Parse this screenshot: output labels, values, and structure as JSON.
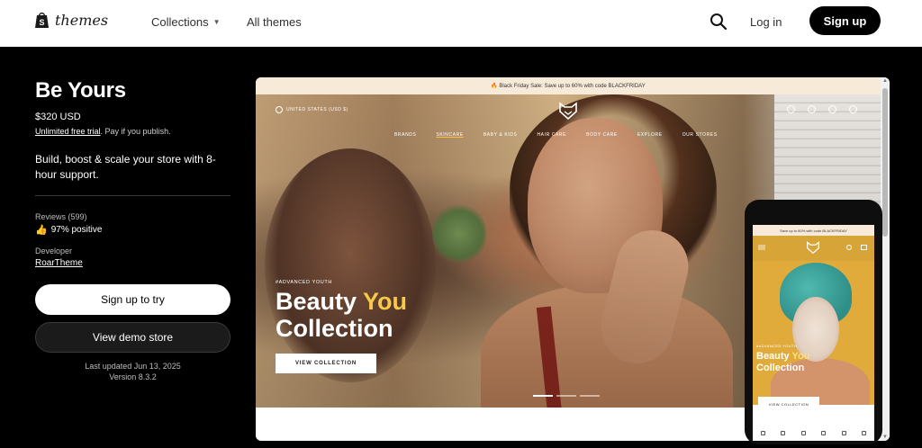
{
  "topnav": {
    "brand": "themes",
    "collections_label": "Collections",
    "all_themes_label": "All themes",
    "login_label": "Log in",
    "signup_label": "Sign up"
  },
  "theme": {
    "name": "Be Yours",
    "price": "$320 USD",
    "trial_link": "Unlimited free trial",
    "trial_suffix": ". Pay if you publish.",
    "tagline": "Build, boost & scale your store with 8-hour support.",
    "reviews_label": "Reviews (599)",
    "reviews_value": "97% positive",
    "developer_label": "Developer",
    "developer_name": "RoarTheme",
    "try_button": "Sign up to try",
    "demo_button": "View demo store",
    "last_updated": "Last updated Jun 13, 2025",
    "version": "Version 8.3.2"
  },
  "preview": {
    "announcement": "🔥 Black Friday Sale: Save up to 60% with code BLACKFRIDAY",
    "locale": "UNITED STATES (USD $)",
    "nav": [
      "BRANDS",
      "SKINCARE",
      "BABY & KIDS",
      "HAIR CARE",
      "BODY CARE",
      "EXPLORE",
      "OUR STORES"
    ],
    "kicker": "#ADVANCED YOUTH",
    "title_line1_a": "Beauty ",
    "title_line1_b": "You",
    "title_line2": "Collection",
    "cta": "VIEW COLLECTION"
  },
  "phone": {
    "announcement": "Save up to 60% with code BLACKFRIDAY",
    "kicker": "#ADVANCED YOUTH",
    "title_line1_a": "Beauty ",
    "title_line1_b": "You",
    "title_line2": "Collection",
    "cta": "VIEW COLLECTION"
  },
  "colors": {
    "accent_yellow": "#f7c948",
    "topbar_bg": "#ffffff",
    "page_bg": "#000000"
  }
}
